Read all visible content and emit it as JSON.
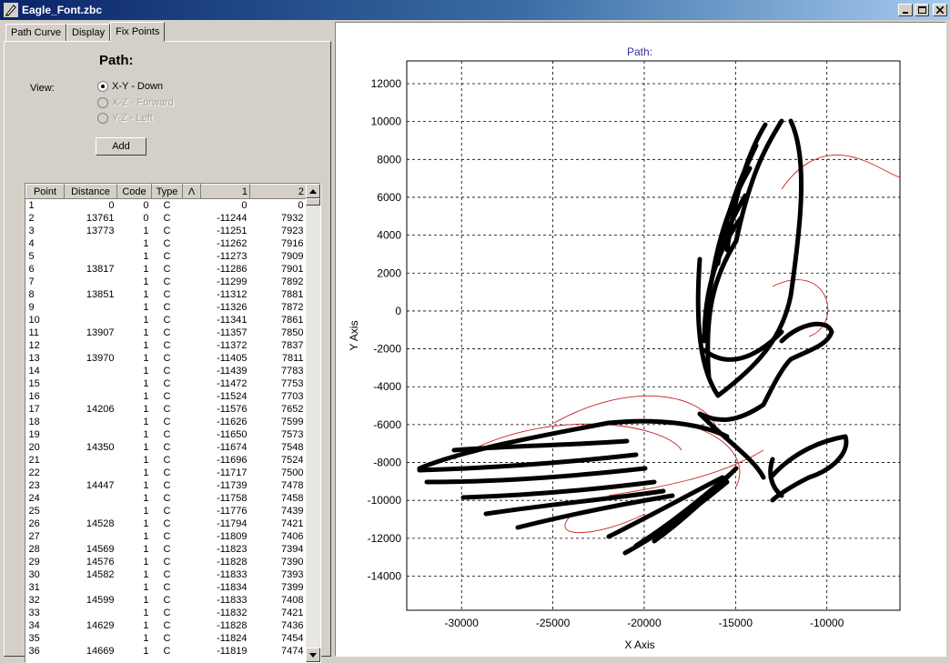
{
  "window": {
    "title": "Eagle_Font.zbc",
    "app_icon": "pen-icon",
    "buttons": [
      "minimize-icon",
      "maximize-icon",
      "close-icon"
    ]
  },
  "tabs": [
    {
      "label": "Path Curve",
      "active": false
    },
    {
      "label": "Display",
      "active": false
    },
    {
      "label": "Fix Points",
      "active": true
    }
  ],
  "panel": {
    "heading": "Path:",
    "view_label": "View:",
    "views": [
      {
        "label": "X-Y  -  Down",
        "checked": true,
        "enabled": true
      },
      {
        "label": "X-Z  -  Forward",
        "checked": false,
        "enabled": false
      },
      {
        "label": "Y-Z  -  Left",
        "checked": false,
        "enabled": false
      }
    ],
    "add_label": "Add"
  },
  "grid": {
    "columns": [
      "Point",
      "Distance",
      "Code",
      "Type",
      "Λ",
      "1",
      "2"
    ],
    "rows": [
      [
        "1",
        "0",
        "0",
        "C",
        "",
        "0",
        "0"
      ],
      [
        "2",
        "13761",
        "0",
        "C",
        "",
        "-11244",
        "7932"
      ],
      [
        "3",
        "13773",
        "1",
        "C",
        "",
        "-11251",
        "7923"
      ],
      [
        "4",
        "",
        "1",
        "C",
        "",
        "-11262",
        "7916"
      ],
      [
        "5",
        "",
        "1",
        "C",
        "",
        "-11273",
        "7909"
      ],
      [
        "6",
        "13817",
        "1",
        "C",
        "",
        "-11286",
        "7901"
      ],
      [
        "7",
        "",
        "1",
        "C",
        "",
        "-11299",
        "7892"
      ],
      [
        "8",
        "13851",
        "1",
        "C",
        "",
        "-11312",
        "7881"
      ],
      [
        "9",
        "",
        "1",
        "C",
        "",
        "-11326",
        "7872"
      ],
      [
        "10",
        "",
        "1",
        "C",
        "",
        "-11341",
        "7861"
      ],
      [
        "11",
        "13907",
        "1",
        "C",
        "",
        "-11357",
        "7850"
      ],
      [
        "12",
        "",
        "1",
        "C",
        "",
        "-11372",
        "7837"
      ],
      [
        "13",
        "13970",
        "1",
        "C",
        "",
        "-11405",
        "7811"
      ],
      [
        "14",
        "",
        "1",
        "C",
        "",
        "-11439",
        "7783"
      ],
      [
        "15",
        "",
        "1",
        "C",
        "",
        "-11472",
        "7753"
      ],
      [
        "16",
        "",
        "1",
        "C",
        "",
        "-11524",
        "7703"
      ],
      [
        "17",
        "14206",
        "1",
        "C",
        "",
        "-11576",
        "7652"
      ],
      [
        "18",
        "",
        "1",
        "C",
        "",
        "-11626",
        "7599"
      ],
      [
        "19",
        "",
        "1",
        "C",
        "",
        "-11650",
        "7573"
      ],
      [
        "20",
        "14350",
        "1",
        "C",
        "",
        "-11674",
        "7548"
      ],
      [
        "21",
        "",
        "1",
        "C",
        "",
        "-11696",
        "7524"
      ],
      [
        "22",
        "",
        "1",
        "C",
        "",
        "-11717",
        "7500"
      ],
      [
        "23",
        "14447",
        "1",
        "C",
        "",
        "-11739",
        "7478"
      ],
      [
        "24",
        "",
        "1",
        "C",
        "",
        "-11758",
        "7458"
      ],
      [
        "25",
        "",
        "1",
        "C",
        "",
        "-11776",
        "7439"
      ],
      [
        "26",
        "14528",
        "1",
        "C",
        "",
        "-11794",
        "7421"
      ],
      [
        "27",
        "",
        "1",
        "C",
        "",
        "-11809",
        "7406"
      ],
      [
        "28",
        "14569",
        "1",
        "C",
        "",
        "-11823",
        "7394"
      ],
      [
        "29",
        "14576",
        "1",
        "C",
        "",
        "-11828",
        "7390"
      ],
      [
        "30",
        "14582",
        "1",
        "C",
        "",
        "-11833",
        "7393"
      ],
      [
        "31",
        "",
        "1",
        "C",
        "",
        "-11834",
        "7399"
      ],
      [
        "32",
        "14599",
        "1",
        "C",
        "",
        "-11833",
        "7408"
      ],
      [
        "33",
        "",
        "1",
        "C",
        "",
        "-11832",
        "7421"
      ],
      [
        "34",
        "14629",
        "1",
        "C",
        "",
        "-11828",
        "7436"
      ],
      [
        "35",
        "",
        "1",
        "C",
        "",
        "-11824",
        "7454"
      ],
      [
        "36",
        "14669",
        "1",
        "C",
        "",
        "-11819",
        "7474"
      ]
    ]
  },
  "plot": {
    "title": "Path:",
    "xlabel": "X Axis",
    "ylabel": "Y Axis",
    "xlim": [
      -33000,
      -6000
    ],
    "ylim": [
      -15800,
      13200
    ],
    "xticks": [
      -30000,
      -25000,
      -20000,
      -15000,
      -10000
    ],
    "yticks": [
      12000,
      10000,
      8000,
      6000,
      4000,
      2000,
      0,
      -2000,
      -4000,
      -6000,
      -8000,
      -10000,
      -12000,
      -14000
    ],
    "grid": true,
    "path_color": "#000000",
    "curve_color": "#cc2222",
    "title_color": "#333399"
  }
}
